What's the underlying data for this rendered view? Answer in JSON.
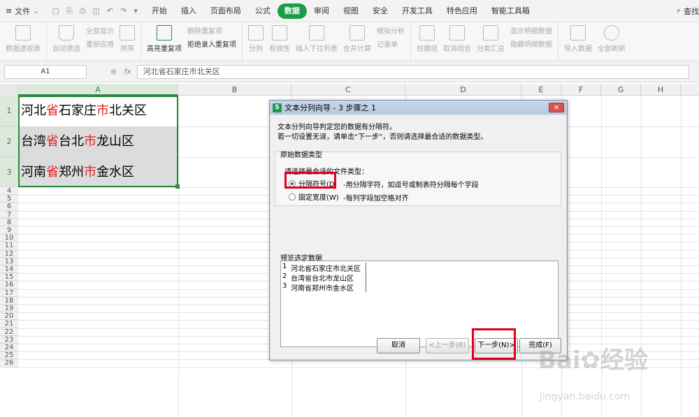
{
  "menubar": {
    "file_label": "文件",
    "tabs": [
      "开始",
      "插入",
      "页面布局",
      "公式",
      "数据",
      "审阅",
      "视图",
      "安全",
      "开发工具",
      "特色应用",
      "智能工具箱"
    ],
    "active_tab": "数据",
    "search_label": "查找"
  },
  "ribbon": {
    "pivot": "数据透视表",
    "autofilter": "自动筛选",
    "show_all": "全部显示",
    "reapply": "重新应用",
    "sort": "排序",
    "highlight_dup": "高亮重复项",
    "delete_dup": "删除重复项",
    "reject_dup": "拒绝录入重复项",
    "split": "分列",
    "validity": "有效性",
    "insert_dropdown": "插入下拉列表",
    "consolidate": "合并计算",
    "simulate": "模拟分析",
    "record": "记录单",
    "create_group": "创建组",
    "ungroup": "取消组合",
    "subtotal": "分类汇总",
    "show_detail": "显示明细数据",
    "hide_detail": "隐藏明细数据",
    "import": "导入数据",
    "refresh_all": "全部刷新"
  },
  "formula_bar": {
    "cell_ref": "A1",
    "fx": "fx",
    "value": "河北省石家庄市北关区"
  },
  "columns": [
    "A",
    "B",
    "C",
    "D",
    "E",
    "F",
    "G",
    "H"
  ],
  "rows": [
    "1",
    "2",
    "3",
    "4",
    "5",
    "6",
    "7",
    "8",
    "9",
    "10",
    "11",
    "12",
    "13",
    "14",
    "15",
    "16",
    "17",
    "18",
    "19",
    "20",
    "21",
    "22",
    "23",
    "24",
    "25",
    "26"
  ],
  "cells": [
    {
      "p1": "河北",
      "r1": "省",
      "p2": "石家庄",
      "r2": "市",
      "p3": "北关区"
    },
    {
      "p1": "台湾",
      "r1": "省",
      "p2": "台北",
      "r2": "市",
      "p3": "龙山区"
    },
    {
      "p1": "河南",
      "r1": "省",
      "p2": "郑州",
      "r2": "市",
      "p3": "金水区"
    }
  ],
  "dialog": {
    "title": "文本分列向导 - 3 步骤之 1",
    "intro1": "文本分列向导判定您的数据有分隔符。",
    "intro2": "若一切设置无误，请单击“下一步”，否则请选择最合适的数据类型。",
    "group_label": "原始数据类型",
    "choose_label": "请选择最合适的文件类型：",
    "opt_delim": "分隔符号(D",
    "opt_delim_desc": "-用分隔字符，如逗号或制表符分隔每个字段",
    "opt_fixed": "固定宽度(W)",
    "opt_fixed_desc": "-每列字段加空格对齐",
    "preview_label": "预览选定数据",
    "preview_rows": [
      {
        "n": "1",
        "t": "河北省石家庄市北关区"
      },
      {
        "n": "2",
        "t": "台湾省台北市龙山区"
      },
      {
        "n": "3",
        "t": "河南省郑州市金水区"
      }
    ],
    "btn_cancel": "取消",
    "btn_prev": "<上一步(B)",
    "btn_next": "下一步(N)>",
    "btn_finish": "完成(F)"
  },
  "watermark": {
    "brand": "Bai",
    "brand2": "经验",
    "url": "jingyan.baidu.com"
  },
  "colors": {
    "accent": "#1c9b4a",
    "highlight_red": "#e02020",
    "annot_red": "#e0001b"
  }
}
